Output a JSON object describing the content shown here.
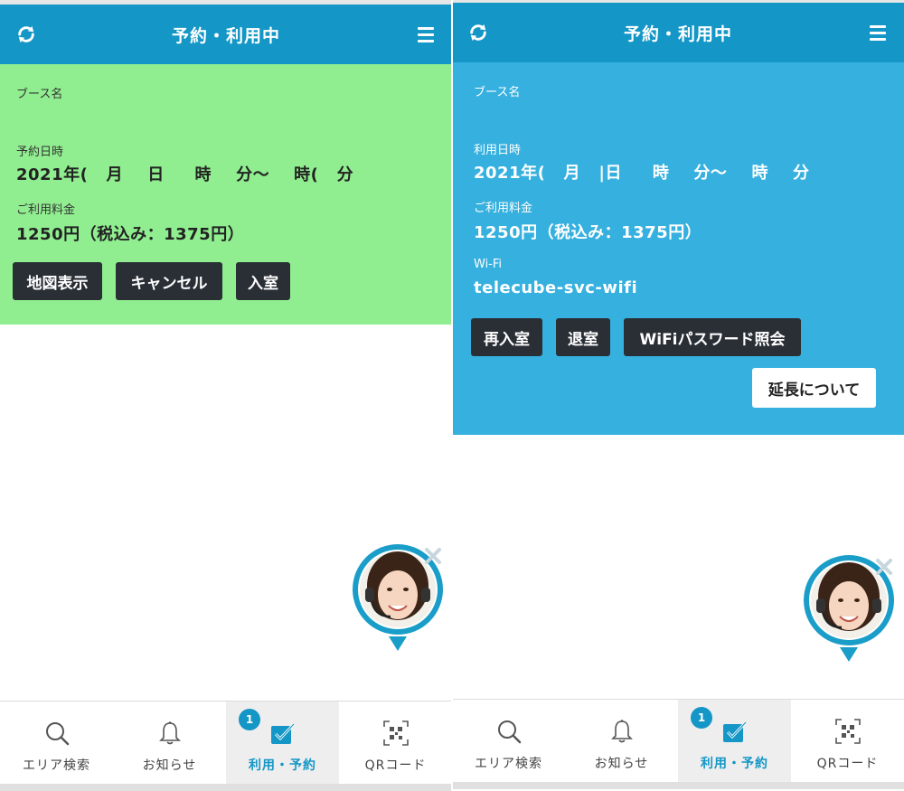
{
  "header": {
    "title": "予約・利用中"
  },
  "left": {
    "booth_label": "ブース名",
    "booth_value": "",
    "datetime_label": "予約日時",
    "datetime_value": "2021年(   月    日     時    分～    時(   分",
    "fee_label": "ご利用料金",
    "fee_value": "1250円（税込み：1375円）",
    "buttons": {
      "map": "地図表示",
      "cancel": "キャンセル",
      "enter": "入室"
    }
  },
  "right": {
    "booth_label": "ブース名",
    "datetime_label": "利用日時",
    "datetime_value": "2021年(   月   |日     時    分～    時    分",
    "fee_label": "ご利用料金",
    "fee_value": "1250円（税込み：1375円）",
    "wifi_label": "Wi-Fi",
    "wifi_value": "telecube-svc-wifi",
    "buttons": {
      "reenter": "再入室",
      "exit": "退室",
      "wifi_password": "WiFiパスワード照会",
      "extension": "延長について"
    }
  },
  "nav": {
    "items": [
      {
        "label": "エリア検索",
        "icon": "search-icon"
      },
      {
        "label": "お知らせ",
        "icon": "bell-icon"
      },
      {
        "label": "利用・予約",
        "icon": "checkbox-icon",
        "active": true,
        "badge": "1"
      },
      {
        "label": "QRコード",
        "icon": "qr-code-icon"
      }
    ]
  },
  "colors": {
    "header": "#1496c6",
    "left_card": "#90ee90",
    "right_card": "#36b0de",
    "button_dark": "#2a2f36",
    "active_nav": "#1496c6"
  }
}
